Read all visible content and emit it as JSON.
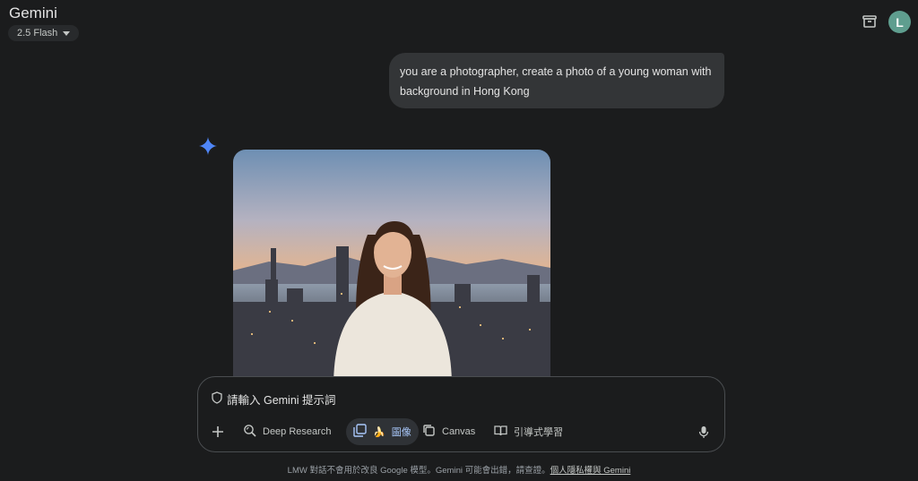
{
  "app": {
    "title": "Gemini",
    "model": "2.5 Flash",
    "avatar_letter": "L"
  },
  "chat": {
    "user_message": "you are a photographer, create a photo of a young woman with background in Hong Kong"
  },
  "composer": {
    "placeholder": "請輸入 Gemini 提示詞",
    "tools": {
      "deep_research": "Deep Research",
      "image_emoji": "🍌",
      "image": "圖像",
      "canvas": "Canvas",
      "guided_learning": "引導式學習"
    }
  },
  "footer": {
    "text": "LMW 對話不會用於改良 Google 模型。Gemini 可能會出錯，請查證。",
    "link": "個人隱私權與 Gemini"
  },
  "colors": {
    "accent": "#a8c7fa",
    "sparkle": "#4f86f7",
    "avatar": "#5f9e8f"
  },
  "icons": [
    "archive-icon",
    "sparkle-icon",
    "shield-icon",
    "plus-icon",
    "deep-research-icon",
    "image-icon",
    "canvas-icon",
    "guided-learning-icon",
    "mic-icon"
  ]
}
